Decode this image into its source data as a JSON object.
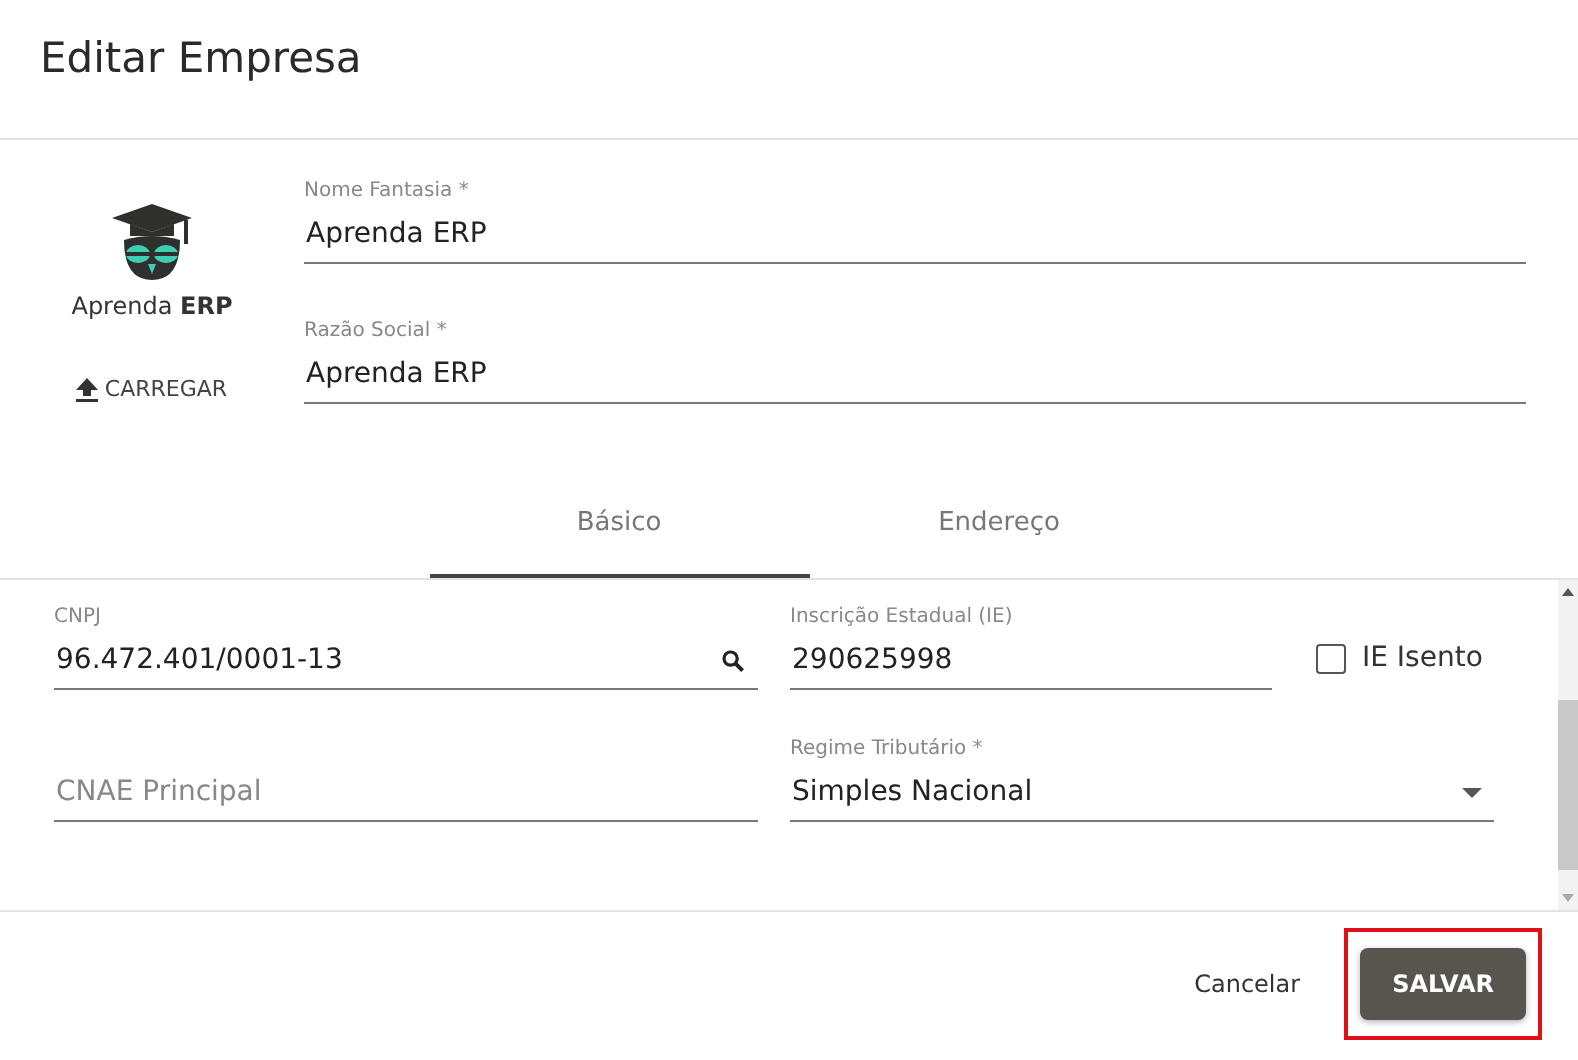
{
  "dialog": {
    "title": "Editar Empresa"
  },
  "logo": {
    "caption": "Aprenda **ERP**",
    "upload": "CARREGAR"
  },
  "header_fields": [
    {
      "label": "Nome Fantasia *",
      "value": "Aprenda ERP"
    },
    {
      "label": "Razão Social *",
      "value": "Aprenda ERP"
    }
  ],
  "tabs": [
    {
      "label": "Básico",
      "selected": true
    },
    {
      "label": "Endereço",
      "selected": false
    }
  ],
  "form_rows": [
    [
      {
        "kind": "search",
        "label": "CNPJ",
        "value": "96.472.401/0001-13"
      },
      {
        "kind": "text",
        "label": "Inscrição Estadual (IE)",
        "value": "290625998"
      },
      {
        "kind": "checkbox",
        "label": "IE Isento",
        "checked": false
      }
    ],
    [
      {
        "kind": "text",
        "placeholder": "CNAE Principal"
      },
      {
        "kind": "select",
        "label": "Regime Tributário *",
        "value": "Simples Nacional"
      }
    ]
  ],
  "footer": {
    "cancel": "Cancelar",
    "save": "SALVAR",
    "save_highlighted": true
  }
}
